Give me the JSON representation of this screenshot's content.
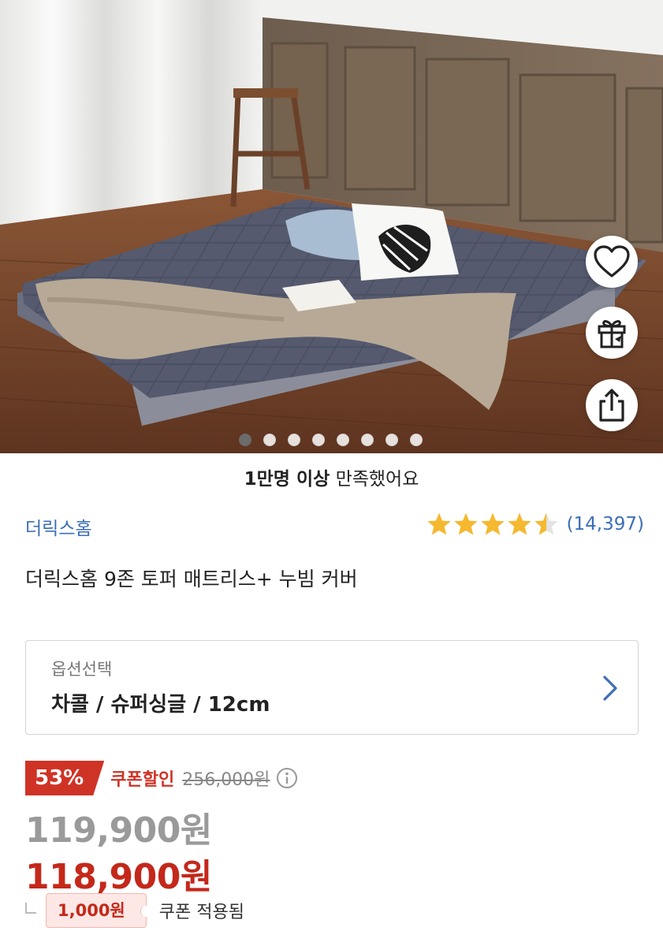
{
  "hero": {
    "image_description_icon": "product-photo",
    "slide_count": 8,
    "active_slide_index": 0
  },
  "actions": {
    "wishlist_icon": "heart-icon",
    "gift_icon": "gift-icon",
    "share_icon": "share-icon"
  },
  "satisfaction": {
    "bold": "1만명 이상",
    "rest": " 만족했어요"
  },
  "product": {
    "brand": "더릭스홈",
    "title": "더릭스홈 9존 토퍼 매트리스+ 누빔 커버",
    "rating_value": 4.5,
    "review_count": "(14,397)"
  },
  "option": {
    "label": "옵션선택",
    "value": "차콜 / 슈퍼싱글 / 12cm"
  },
  "pricing": {
    "discount_rate": "53%",
    "coupon_label": "쿠폰할인",
    "original_price": "256,000원",
    "sale_price": "119,900원",
    "final_price": "118,900원",
    "coupon_amount": "1,000원",
    "coupon_applied_text": "쿠폰 적용됨"
  },
  "colors": {
    "accent_blue": "#3d6fb6",
    "discount_red": "#cf3326",
    "price_red": "#c4281a",
    "star": "#f5b82e"
  }
}
